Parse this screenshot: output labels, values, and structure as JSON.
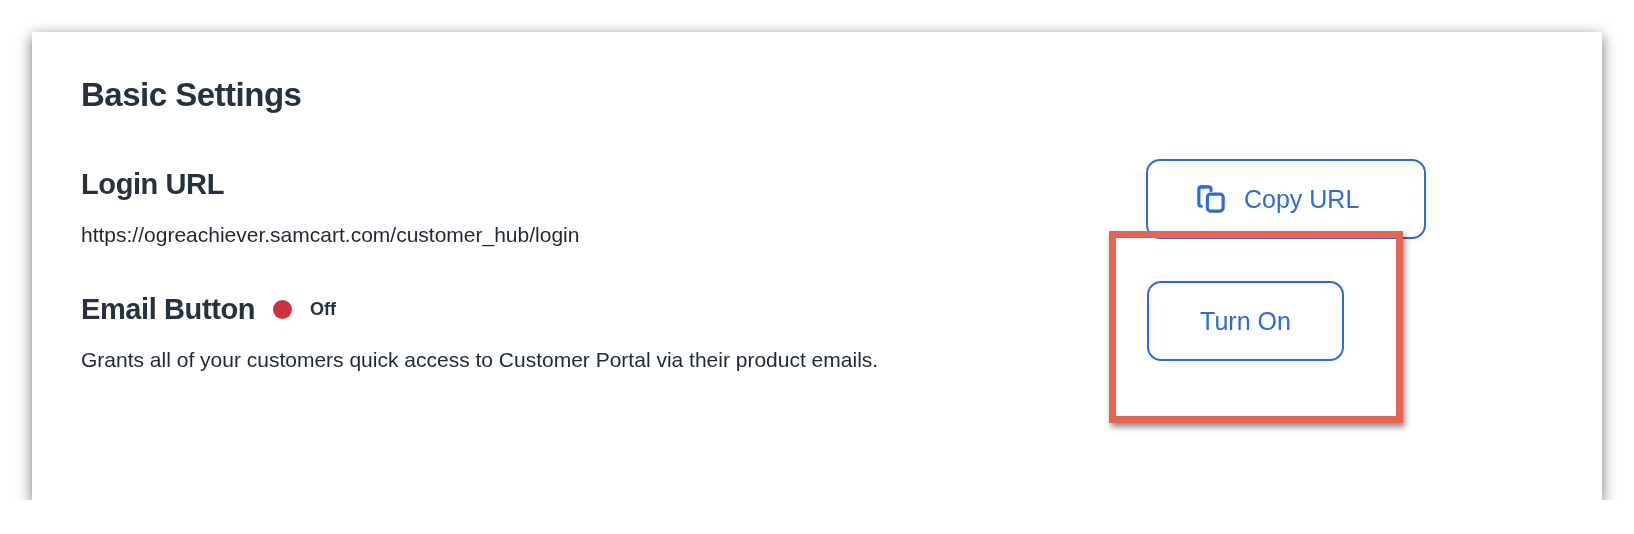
{
  "card": {
    "title": "Basic Settings"
  },
  "login_url": {
    "title": "Login URL",
    "url": "https://ogreachiever.samcart.com/customer_hub/login",
    "button": "Copy URL"
  },
  "email_button": {
    "title": "Email Button",
    "status": {
      "label": "Off",
      "on": false
    },
    "description": "Grants all of your customers quick access to Customer Portal via their product emails.",
    "button": "Turn On",
    "highlighted": true
  }
}
